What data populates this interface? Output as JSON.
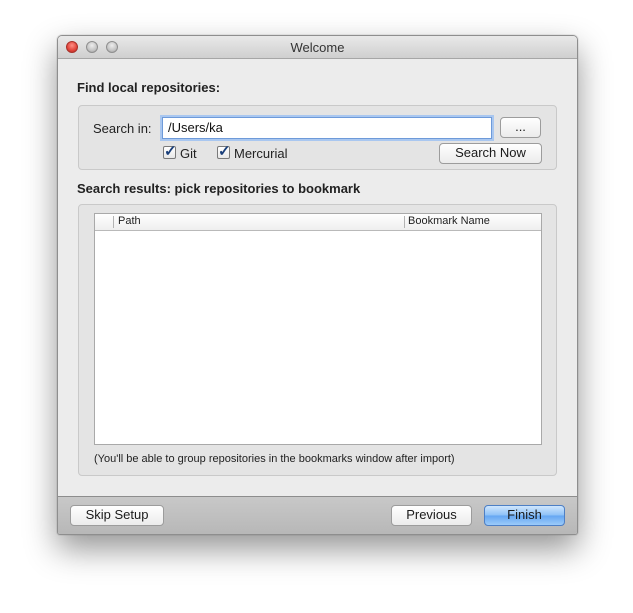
{
  "window": {
    "title": "Welcome"
  },
  "find": {
    "heading": "Find local repositories:",
    "search_label": "Search in:",
    "search_value": "/Users/ka",
    "browse_label": "...",
    "git_label": "Git",
    "git_checked": true,
    "mercurial_label": "Mercurial",
    "mercurial_checked": true,
    "search_now_label": "Search Now"
  },
  "results": {
    "heading": "Search results: pick repositories to bookmark",
    "columns": [
      "Path",
      "Bookmark Name"
    ],
    "rows": [],
    "note": "(You'll be able to group repositories in the bookmarks window after import)"
  },
  "footer": {
    "skip_label": "Skip Setup",
    "previous_label": "Previous",
    "finish_label": "Finish"
  }
}
